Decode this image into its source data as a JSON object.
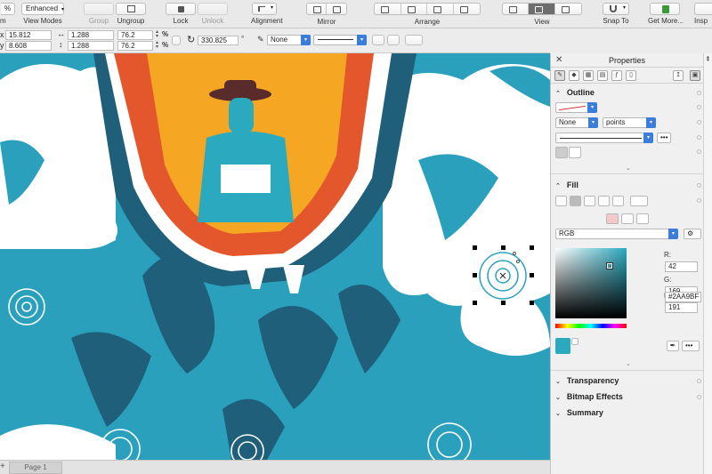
{
  "toolbar": {
    "zoom_partial": "%",
    "zoom_label_partial": "m",
    "view_mode": "Enhanced",
    "view_modes_label": "View Modes",
    "group_label": "Group",
    "ungroup_label": "Ungroup",
    "lock_label": "Lock",
    "unlock_label": "Unlock",
    "alignment_label": "Alignment",
    "mirror_label": "Mirror",
    "arrange_label": "Arrange",
    "view_label": "View",
    "snap_to_label": "Snap To",
    "get_more_label": "Get More...",
    "cut_label": "Insp"
  },
  "property_bar": {
    "x_value": "15.812",
    "y_value": "8.608",
    "width_value": "1.288",
    "height_value": "1.288",
    "scale_x_value": "76.2",
    "scale_y_value": "76.2",
    "percent_unit": "%",
    "rotation_value": "330.825",
    "degree_unit": "°",
    "outline_style_value": "None"
  },
  "page": {
    "tab_label": "Page 1"
  },
  "panel": {
    "title": "Properties",
    "outline": {
      "title": "Outline",
      "none_value": "None",
      "units_value": "points",
      "more_label": "•••"
    },
    "fill": {
      "title": "Fill",
      "color_model": "RGB",
      "r_label": "R:",
      "g_label": "G:",
      "b_label": "B:",
      "r_value": "42",
      "g_value": "169",
      "b_value": "191",
      "hex_value": "#2AA9BF",
      "swatch_color": "#2aa9bf",
      "more_label": "•••"
    },
    "transparency_title": "Transparency",
    "bitmap_effects_title": "Bitmap Effects",
    "summary_title": "Summary"
  },
  "colors": {
    "accent_blue": "#3b7ddd",
    "sky_teal": "#2aa0bd",
    "dark_teal": "#1f5f79",
    "balloon_orange": "#e4562b",
    "balloon_yellow": "#f5a623"
  }
}
